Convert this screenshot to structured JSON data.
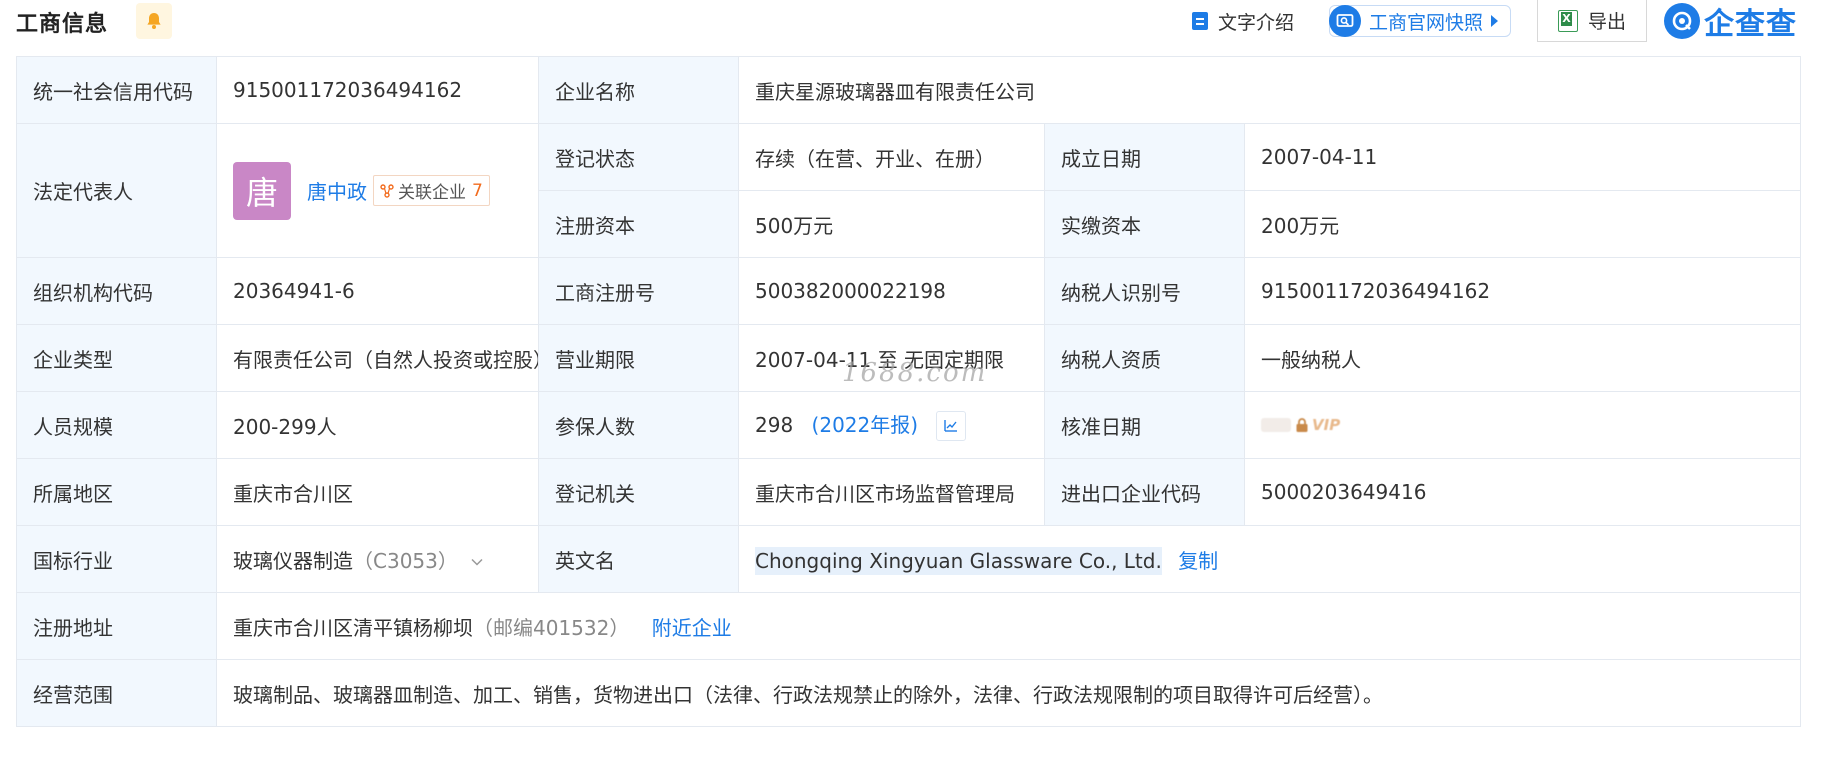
{
  "header": {
    "title": "工商信息",
    "intro_label": "文字介绍",
    "snapshot_label": "工商官网快照",
    "export_label": "导出",
    "brand_text": "企查查"
  },
  "colors": {
    "accent": "#1e7ce6",
    "label_bg": "#f2f8fe",
    "avatar_bg": "#c987c6",
    "tag_count": "#f26b1d"
  },
  "table": {
    "credit_code_label": "统一社会信用代码",
    "credit_code": "91500117203649416​2",
    "company_name_label": "企业名称",
    "company_name": "重庆星源玻璃器皿有限责任公司",
    "legal_rep_label": "法定代表人",
    "legal_rep_avatar": "唐",
    "legal_rep_name": "唐中政",
    "related_label": "关联企业",
    "related_count": "7",
    "reg_status_label": "登记状态",
    "reg_status": "存续（在营、开业、在册）",
    "founded_label": "成立日期",
    "founded": "2007-04-11",
    "reg_capital_label": "注册资本",
    "reg_capital": "500万元",
    "paid_capital_label": "实缴资本",
    "paid_capital": "200万元",
    "org_code_label": "组织机构代码",
    "org_code": "20364941-6",
    "biz_reg_no_label": "工商注册号",
    "biz_reg_no": "500382000022198",
    "taxpayer_id_label": "纳税人识别号",
    "taxpayer_id": "915001172036494162",
    "company_type_label": "企业类型",
    "company_type": "有限责任公司（自然人投资或控股）",
    "biz_term_label": "营业期限",
    "biz_term": "2007-04-11 至 无固定期限",
    "taxpayer_qual_label": "纳税人资质",
    "taxpayer_qual": "一般纳税人",
    "staff_size_label": "人员规模",
    "staff_size": "200-299人",
    "insured_label": "参保人数",
    "insured_count": "298",
    "insured_year": "(2022年报)",
    "approval_date_label": "核准日期",
    "vip_text": "VIP",
    "region_label": "所属地区",
    "region": "重庆市合川区",
    "reg_authority_label": "登记机关",
    "reg_authority": "重庆市合川区市场监督管理局",
    "import_export_label": "进出口企业代码",
    "import_export_code": "5000203649416",
    "industry_label": "国标行业",
    "industry": "玻璃仪器制造",
    "industry_code": "（C3053）",
    "en_name_label": "英文名",
    "en_name": "Chongqing Xingyuan Glassware Co., Ltd.",
    "copy_label": "复制",
    "address_label": "注册地址",
    "address": "重庆市合川区清平镇杨柳坝",
    "postcode": "（邮编401532）",
    "nearby_label": "附近企业",
    "scope_label": "经营范围",
    "scope": "玻璃制品、玻璃器皿制造、加工、销售，货物进出口（法律、行政法规禁止的除外，法律、行政法规限制的项目取得许可后经营）。"
  },
  "watermark": "1688.com"
}
